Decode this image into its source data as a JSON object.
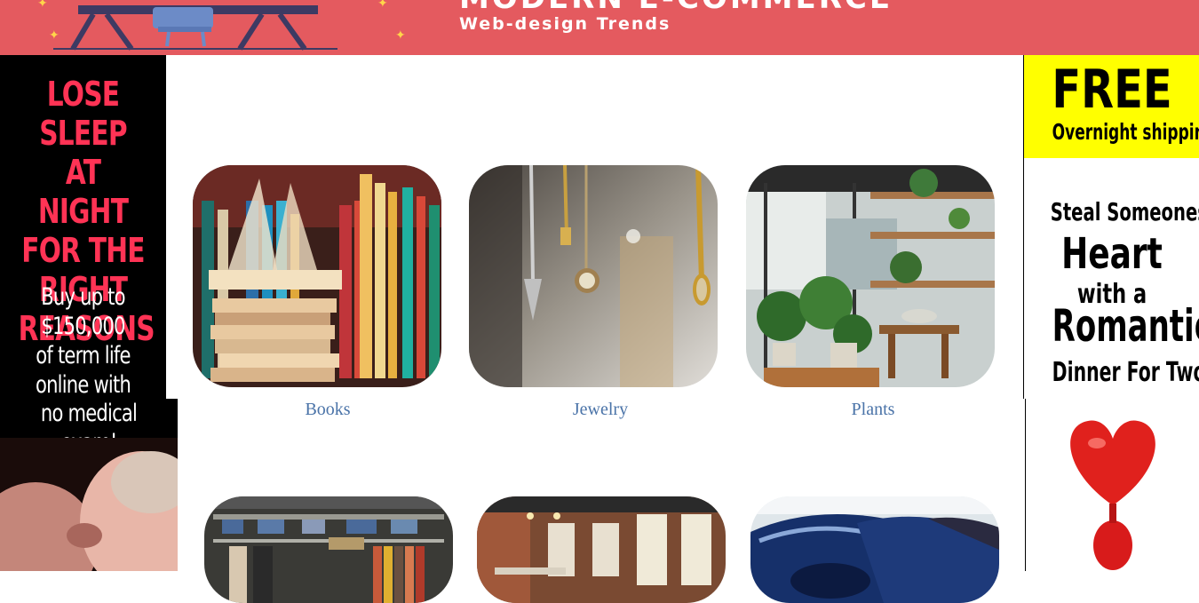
{
  "top_banner": {
    "headline": "MODERN E-COMMERCE",
    "subline": "Web-design Trends",
    "background": "#e45a5f"
  },
  "left_ad": {
    "red_lines": [
      "LOSE SLEEP",
      "AT NIGHT",
      "FOR THE",
      "RIGHT",
      "REASONS"
    ],
    "white_lines": [
      "Buy up to",
      "$150,000",
      "of term life",
      "online with"
    ],
    "white_lines_lower": [
      "no medical exam!"
    ],
    "accent": "#ff3355"
  },
  "right_ad": {
    "free": "FREE",
    "overnight": "Overnight shipping",
    "steal": "Steal Someones",
    "heart_word": "Heart",
    "with": "with a",
    "romantic": "Romantic",
    "dinner": "Dinner For Two!",
    "accent": "#ffff00"
  },
  "categories": [
    {
      "label": "Books",
      "icon": "books-photo"
    },
    {
      "label": "Jewelry",
      "icon": "jewelry-photo"
    },
    {
      "label": "Plants",
      "icon": "plants-photo"
    },
    {
      "label": "",
      "icon": "clothing-store-photo"
    },
    {
      "label": "",
      "icon": "restaurant-photo"
    },
    {
      "label": "",
      "icon": "cars-photo"
    }
  ],
  "colors": {
    "link": "#4a73a8"
  }
}
